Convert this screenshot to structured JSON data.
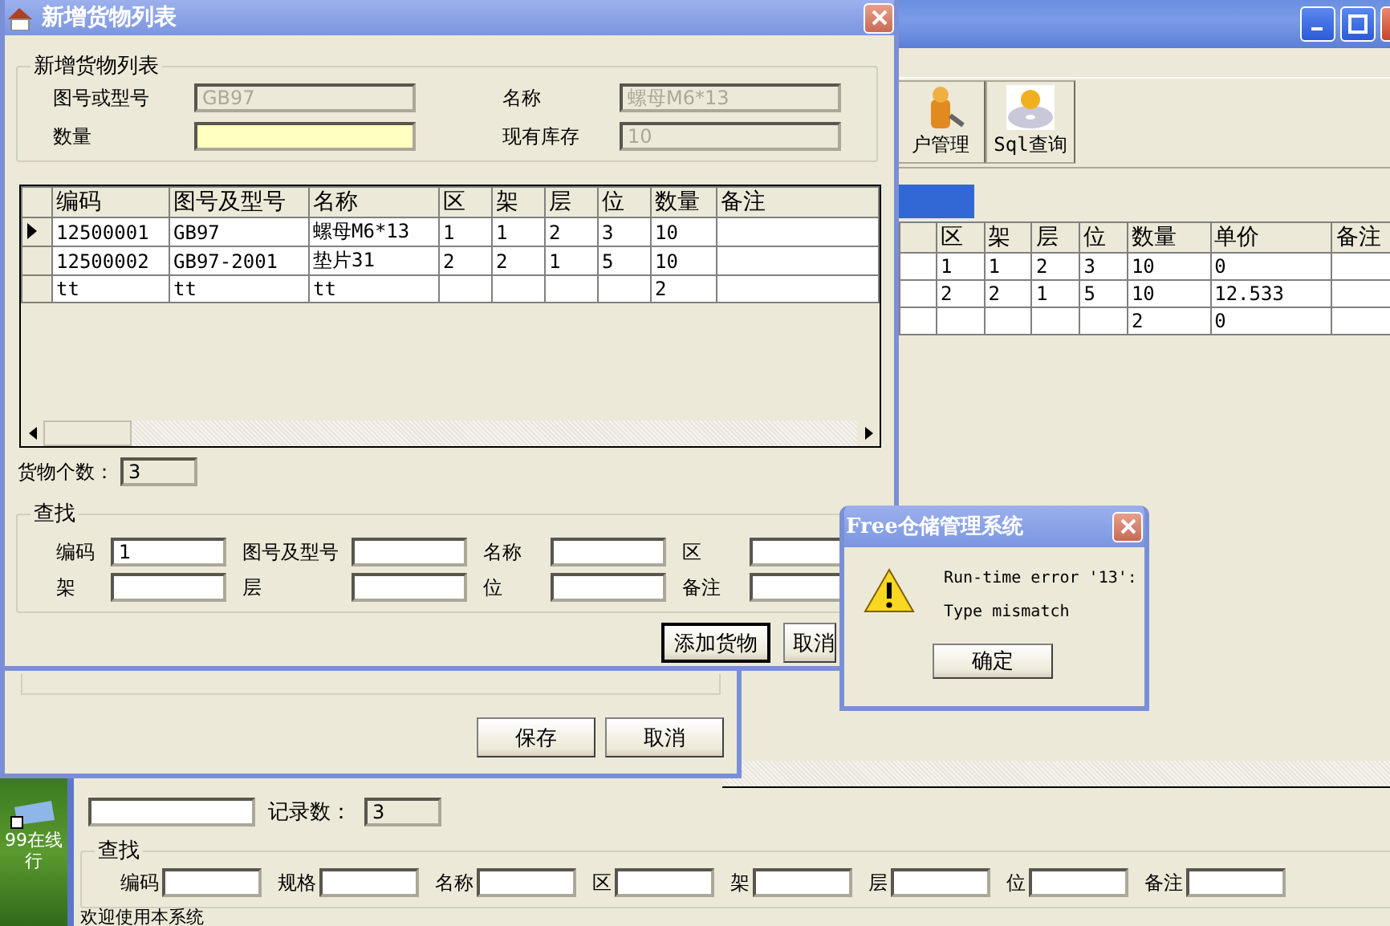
{
  "desktop_icon": {
    "label_lines": [
      "99在线",
      "行"
    ]
  },
  "main_window": {
    "toolbar": [
      {
        "label": "户管理",
        "kind": "user"
      },
      {
        "label": "Sql查询",
        "kind": "disc"
      }
    ],
    "grid": {
      "columns": [
        "区",
        "架",
        "层",
        "位",
        "数量",
        "单价",
        "备注"
      ],
      "rows": [
        [
          "1",
          "1",
          "2",
          "3",
          "10",
          "0",
          null
        ],
        [
          "2",
          "2",
          "1",
          "5",
          "10",
          "12.533",
          null
        ],
        [
          null,
          null,
          null,
          null,
          "2",
          "0",
          null
        ]
      ]
    },
    "record_count_label": "记录数：",
    "record_count": "3",
    "search": {
      "title": "查找",
      "fields": [
        {
          "label": "编码"
        },
        {
          "label": "规格"
        },
        {
          "label": "名称"
        },
        {
          "label": "区"
        },
        {
          "label": "架"
        },
        {
          "label": "层"
        },
        {
          "label": "位"
        },
        {
          "label": "备注"
        }
      ]
    },
    "status_bar": "欢迎使用本系统"
  },
  "middle_window": {
    "buttons": [
      "保存",
      "取消"
    ]
  },
  "add_dialog": {
    "title": "新增货物列表",
    "group_title": "新增货物列表",
    "fields": [
      {
        "label": "图号或型号",
        "value": "GB97",
        "disabled": true,
        "highlighted": false
      },
      {
        "label": "名称",
        "value": "螺母M6*13",
        "disabled": true,
        "highlighted": false
      },
      {
        "label": "数量",
        "disabled": false,
        "highlighted": true
      },
      {
        "label": "现有库存",
        "value": "10",
        "disabled": true,
        "highlighted": false
      }
    ],
    "grid": {
      "columns": [
        "编码",
        "图号及型号",
        "名称",
        "区",
        "架",
        "层",
        "位",
        "数量",
        "备注"
      ],
      "rows": [
        {
          "current": true,
          "cells": [
            "12500001",
            "GB97",
            "螺母M6*13",
            "1",
            "1",
            "2",
            "3",
            "10",
            null
          ]
        },
        {
          "current": false,
          "cells": [
            "12500002",
            "GB97-2001",
            "垫片31",
            "2",
            "2",
            "1",
            "5",
            "10",
            null
          ]
        },
        {
          "current": false,
          "cells": [
            "tt",
            "tt",
            "tt",
            null,
            null,
            null,
            null,
            "2",
            null
          ]
        }
      ]
    },
    "count_label": "货物个数：",
    "count": "3",
    "search": {
      "title": "查找",
      "fields": [
        {
          "label": "编码",
          "value": "1"
        },
        {
          "label": "图号及型号"
        },
        {
          "label": "名称"
        },
        {
          "label": "区"
        },
        {
          "label": "架"
        },
        {
          "label": "层"
        },
        {
          "label": "位"
        },
        {
          "label": "备注"
        }
      ]
    },
    "buttons": [
      {
        "label": "添加货物",
        "default": true
      },
      {
        "label": "取消",
        "default": false
      }
    ]
  },
  "message_box": {
    "title": "Free仓储管理系统",
    "lines": [
      "Run-time error '13':",
      "Type mismatch"
    ],
    "button": "确定"
  }
}
